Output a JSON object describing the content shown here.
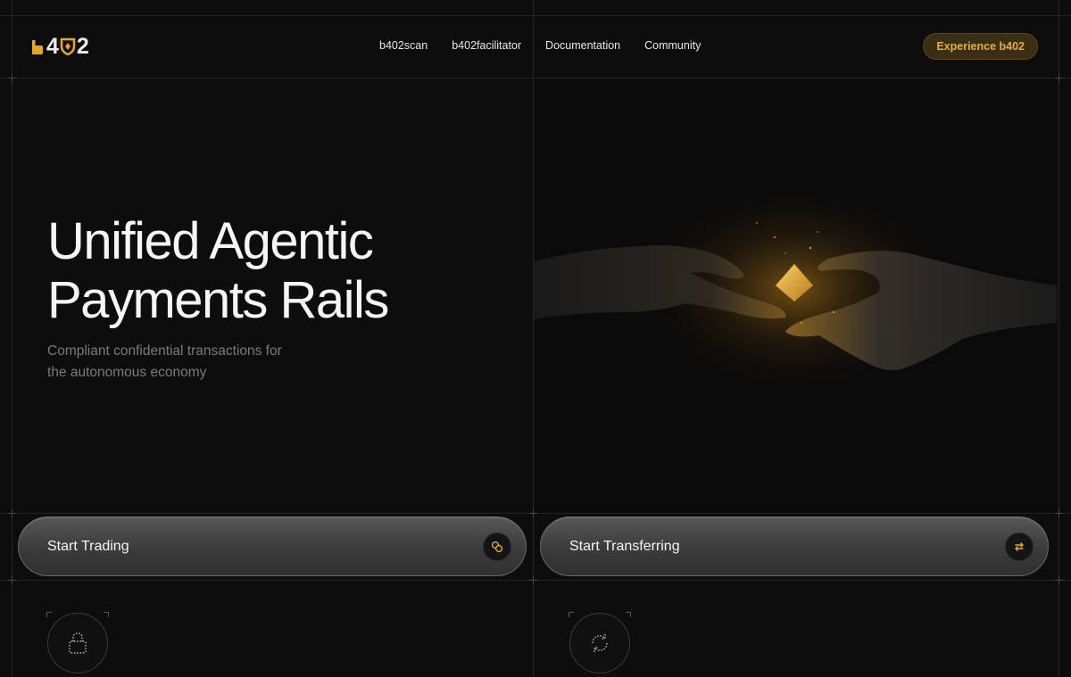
{
  "brand": {
    "logo_text": "b402",
    "accent": "#e7a52a"
  },
  "nav": {
    "items": [
      "b402scan",
      "b402facilitator",
      "Documentation",
      "Community"
    ]
  },
  "header_cta": {
    "label": "Experience b402"
  },
  "hero": {
    "title_line1": "Unified Agentic",
    "title_line2": "Payments Rails",
    "subtitle_line1": "Compliant confidential transactions for",
    "subtitle_line2": "the autonomous economy"
  },
  "actions": [
    {
      "label": "Start Trading",
      "icon": "coins-icon"
    },
    {
      "label": "Start Transferring",
      "icon": "swap-arrows-icon"
    }
  ],
  "features": [
    {
      "icon": "lock-icon"
    },
    {
      "icon": "refresh-icon"
    }
  ],
  "art": {
    "description_icon": "hands-exchanging-crystal-illustration"
  }
}
